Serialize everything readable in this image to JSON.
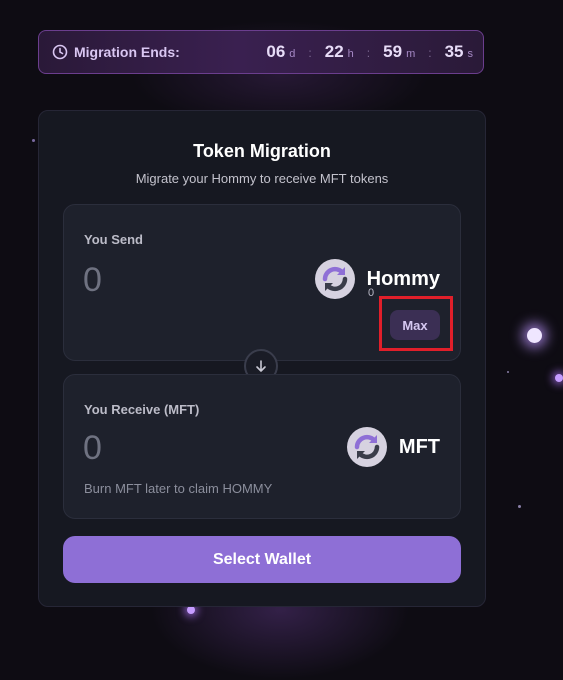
{
  "timer": {
    "label": "Migration Ends:",
    "days": "06",
    "days_unit": "d",
    "hours": "22",
    "hours_unit": "h",
    "minutes": "59",
    "minutes_unit": "m",
    "seconds": "35",
    "seconds_unit": "s",
    "separator": ":"
  },
  "card": {
    "title": "Token Migration",
    "subtitle": "Migrate your Hommy to receive MFT tokens"
  },
  "send": {
    "label": "You Send",
    "amount": "0",
    "token_name": "Hommy",
    "token_icon": "swap-arrows-icon",
    "balance": "0",
    "max_label": "Max"
  },
  "receive": {
    "label": "You Receive (MFT)",
    "amount": "0",
    "token_name": "MFT",
    "token_icon": "swap-arrows-icon",
    "note": "Burn MFT later to claim HOMMY"
  },
  "actions": {
    "select_wallet_label": "Select Wallet"
  },
  "colors": {
    "background": "#0e0c13",
    "accent": "#8e6fd6",
    "highlight": "#e01f2a",
    "timer_border": "#6b3e8e"
  }
}
